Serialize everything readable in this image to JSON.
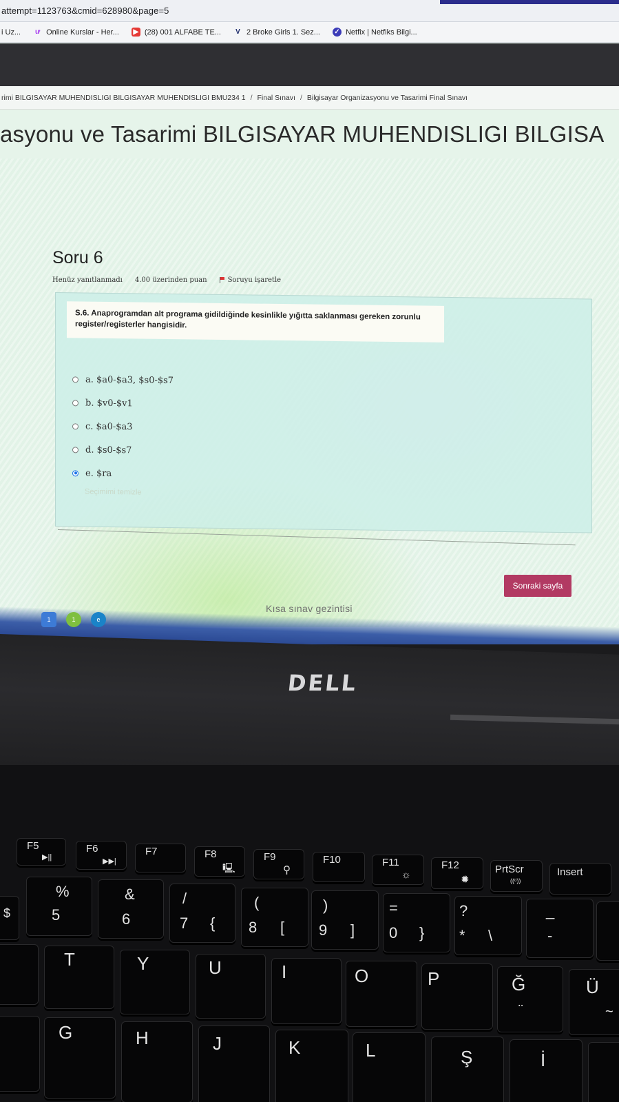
{
  "browser": {
    "url_fragment": "attempt=1123763&cmid=628980&page=5",
    "bookmarks": [
      {
        "icon": "bookmark-icon",
        "label": "i Uz..."
      },
      {
        "icon": "udemy-icon",
        "label": "Online Kurslar - Her..."
      },
      {
        "icon": "youtube-icon",
        "label": "(28) 001 ALFABE TE..."
      },
      {
        "icon": "v-logo-icon",
        "label": "2 Broke Girls 1. Sez..."
      },
      {
        "icon": "netfix-icon",
        "label": "Netfix | Netfiks Bilgi..."
      }
    ]
  },
  "breadcrumb": {
    "course": "rimi BILGISAYAR MUHENDISLIGI BILGISAYAR MUHENDISLIGI BMU234 1",
    "section": "Final Sınavı",
    "current": "Bilgisayar Organizasyonu ve Tasarimi Final Sınavı"
  },
  "page": {
    "heading": "asyonu ve Tasarimi BILGISAYAR MUHENDISLIGI BILGISA"
  },
  "question": {
    "title": "Soru 6",
    "status": "Henüz yanıtlanmadı",
    "points": "4.00 üzerinden puan",
    "flag_label": "Soruyu işaretle",
    "text": "S.6. Anaprogramdan alt programa gidildiğinde kesinlikle yığıtta saklanması gereken zorunlu register/registerler hangisidir.",
    "answers": [
      {
        "label": "a. $a0-$a3, $s0-$s7",
        "selected": false
      },
      {
        "label": "b. $v0-$v1",
        "selected": false
      },
      {
        "label": "c. $a0-$a3",
        "selected": false
      },
      {
        "label": "d. $s0-$s7",
        "selected": false
      },
      {
        "label": "e. $ra",
        "selected": true
      }
    ],
    "clear_label": "Seçimimi temizle"
  },
  "navigation": {
    "next_label": "Sonraki sayfa",
    "quiz_nav_label": "Kısa sınav gezintisi"
  },
  "taskbar": {
    "badge_a": "1",
    "badge_b": "1"
  },
  "laptop": {
    "brand": "DELL"
  },
  "keyboard": {
    "function_row": [
      {
        "main": "F5",
        "sub": "▶||"
      },
      {
        "main": "F6",
        "sub": "▶▶|"
      },
      {
        "main": "F7",
        "sub": ""
      },
      {
        "main": "F8",
        "sub": "🖳"
      },
      {
        "main": "F9",
        "sub": "⚲"
      },
      {
        "main": "F10",
        "sub": ""
      },
      {
        "main": "F11",
        "sub": "☼"
      },
      {
        "main": "F12",
        "sub": "✹"
      },
      {
        "main": "PrtScr",
        "sub": "((ᵒ))"
      },
      {
        "main": "Insert",
        "sub": ""
      }
    ],
    "number_row": [
      {
        "top": "%",
        "main": "5",
        "alt": ""
      },
      {
        "top": "&",
        "main": "6",
        "alt": ""
      },
      {
        "top": "/",
        "main": "7",
        "alt": "{"
      },
      {
        "top": "(",
        "main": "8",
        "alt": "["
      },
      {
        "top": ")",
        "main": "9",
        "alt": "]"
      },
      {
        "top": "=",
        "main": "0",
        "alt": "}"
      },
      {
        "top": "?",
        "main": "*",
        "alt": "\\"
      },
      {
        "top": "_",
        "main": "-",
        "alt": ""
      }
    ],
    "letter_row": [
      "T",
      "Y",
      "U",
      "I",
      "O",
      "P",
      "Ğ",
      "Ü"
    ],
    "letter_row_extras": {
      "g_breve_alt": "¨",
      "u_umlaut_alt": "~"
    },
    "home_row": [
      "G",
      "H",
      "J",
      "K",
      "L",
      "Ş",
      "İ"
    ]
  }
}
